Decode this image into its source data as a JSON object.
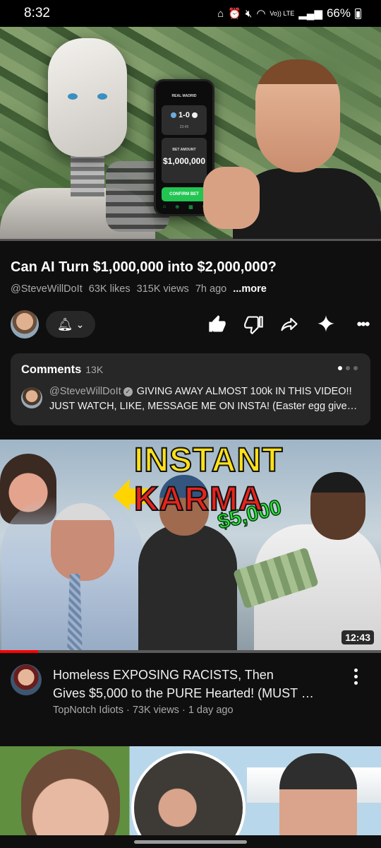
{
  "status_bar": {
    "time": "8:32",
    "network_label": "Vo)) LTE",
    "battery": "66%",
    "icons": [
      "lock-screen-icon",
      "alarm-icon",
      "mute-icon",
      "wifi-icon",
      "signal-icon",
      "battery-icon"
    ]
  },
  "player": {
    "phone_screen": {
      "header": "REAL MADRID",
      "score": "1-0",
      "clock": "23:45",
      "bet_label": "BET AMOUNT",
      "amount": "$1,000,000",
      "confirm": "CONFIRM BET"
    }
  },
  "video": {
    "title": "Can AI Turn $1,000,000 into $2,000,000?",
    "channel": "@SteveWillDoIt",
    "likes": "63K likes",
    "views": "315K views",
    "age": "7h ago",
    "more": "...more"
  },
  "actions": {
    "subscribe_state": "bell",
    "icons": [
      "like-icon",
      "dislike-icon",
      "share-icon",
      "sparkle-icon",
      "more-icon"
    ]
  },
  "comments": {
    "label": "Comments",
    "count": "13K",
    "top_comment": {
      "author": "@SteveWillDoIt",
      "line1": "GIVING AWAY ALMOST 100k IN THIS VIDEO!!",
      "line2": "JUST WATCH, LIKE, MESSAGE ME ON INSTA! (Easter egg givea…"
    }
  },
  "next_video": {
    "thumbnail_text_1": "INSTANT",
    "thumbnail_text_2": "KARMA",
    "thumbnail_money": "$5,000",
    "duration": "12:43",
    "watched_fraction": 0.1,
    "title_line1": "Homeless EXPOSING RACISTS, Then",
    "title_line2": "Gives $5,000 to the PURE Hearted! (MUST …",
    "channel": "TopNotch Idiots",
    "views": "73K views",
    "age": "1 day ago",
    "separator": " · "
  },
  "colors": {
    "background": "#0f0f0f",
    "card": "#272727",
    "secondary_text": "#aaaaaa",
    "progress_red": "#ff0000",
    "karma_yellow": "#ffe01a",
    "karma_red": "#e8231d",
    "money_green": "#2ee640"
  }
}
